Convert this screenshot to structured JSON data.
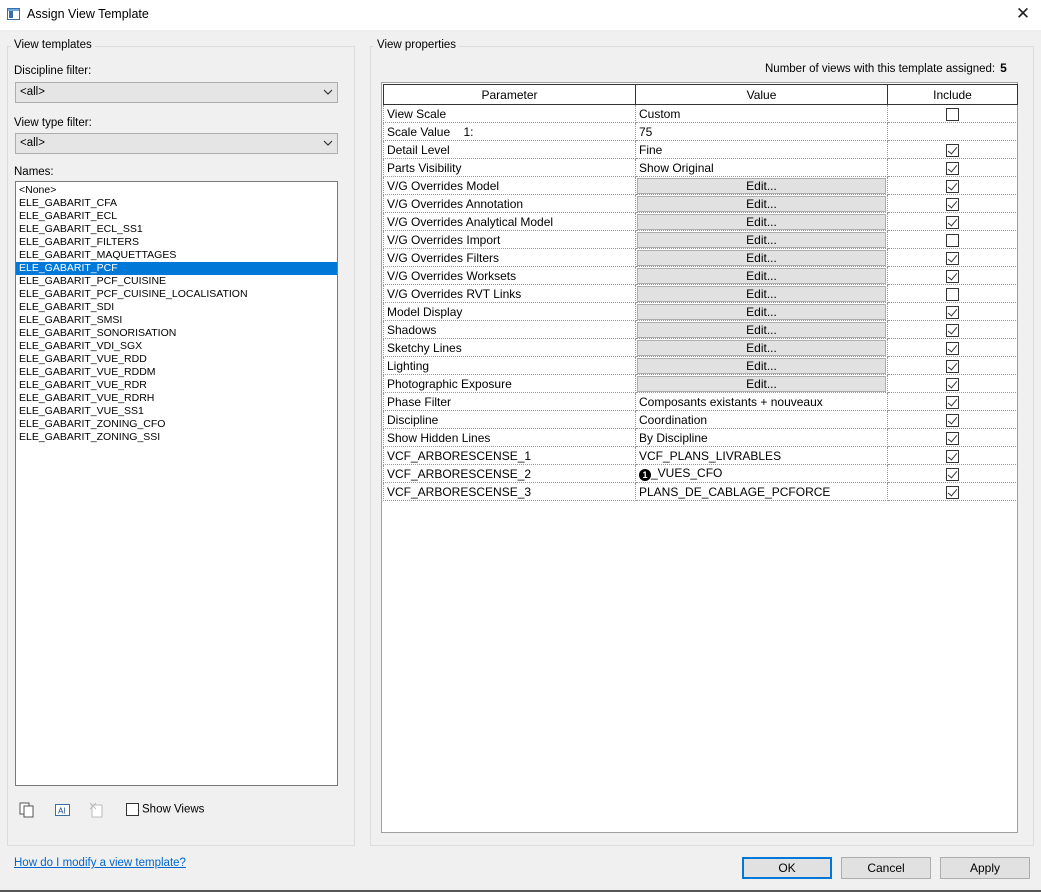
{
  "window": {
    "title": "Assign View Template",
    "close_glyph": "✕"
  },
  "left": {
    "group_title": "View templates",
    "discipline_filter": {
      "label": "Discipline filter:",
      "value": "<all>"
    },
    "view_type_filter": {
      "label": "View type filter:",
      "value": "<all>"
    },
    "names_label": "Names:",
    "names": [
      "<None>",
      "ELE_GABARIT_CFA",
      "ELE_GABARIT_ECL",
      "ELE_GABARIT_ECL_SS1",
      "ELE_GABARIT_FILTERS",
      "ELE_GABARIT_MAQUETTAGES",
      "ELE_GABARIT_PCF",
      "ELE_GABARIT_PCF_CUISINE",
      "ELE_GABARIT_PCF_CUISINE_LOCALISATION",
      "ELE_GABARIT_SDI",
      "ELE_GABARIT_SMSI",
      "ELE_GABARIT_SONORISATION",
      "ELE_GABARIT_VDI_SGX",
      "ELE_GABARIT_VUE_RDD",
      "ELE_GABARIT_VUE_RDDM",
      "ELE_GABARIT_VUE_RDR",
      "ELE_GABARIT_VUE_RDRH",
      "ELE_GABARIT_VUE_SS1",
      "ELE_GABARIT_ZONING_CFO",
      "ELE_GABARIT_ZONING_SSI"
    ],
    "selected_name": "ELE_GABARIT_PCF",
    "tools": [
      "duplicate-icon",
      "rename-icon",
      "delete-icon"
    ],
    "show_views_label": "Show Views",
    "show_views_checked": false
  },
  "right": {
    "group_title": "View properties",
    "count_label": "Number of views with this template assigned:",
    "count_value": "5",
    "columns": [
      "Parameter",
      "Value",
      "Include"
    ],
    "rows": [
      {
        "param": "View Scale",
        "value": "Custom",
        "edit": false,
        "include": false
      },
      {
        "param": "Scale Value    1:",
        "value": "75",
        "edit": false,
        "include": null
      },
      {
        "param": "Detail Level",
        "value": "Fine",
        "edit": false,
        "include": true
      },
      {
        "param": "Parts Visibility",
        "value": "Show Original",
        "edit": false,
        "include": true
      },
      {
        "param": "V/G Overrides Model",
        "value": "Edit...",
        "edit": true,
        "include": true
      },
      {
        "param": "V/G Overrides Annotation",
        "value": "Edit...",
        "edit": true,
        "include": true
      },
      {
        "param": "V/G Overrides Analytical Model",
        "value": "Edit...",
        "edit": true,
        "include": true
      },
      {
        "param": "V/G Overrides Import",
        "value": "Edit...",
        "edit": true,
        "include": false
      },
      {
        "param": "V/G Overrides Filters",
        "value": "Edit...",
        "edit": true,
        "include": true
      },
      {
        "param": "V/G Overrides Worksets",
        "value": "Edit...",
        "edit": true,
        "include": true
      },
      {
        "param": "V/G Overrides RVT Links",
        "value": "Edit...",
        "edit": true,
        "include": false
      },
      {
        "param": "Model Display",
        "value": "Edit...",
        "edit": true,
        "include": true
      },
      {
        "param": "Shadows",
        "value": "Edit...",
        "edit": true,
        "include": true
      },
      {
        "param": "Sketchy Lines",
        "value": "Edit...",
        "edit": true,
        "include": true
      },
      {
        "param": "Lighting",
        "value": "Edit...",
        "edit": true,
        "include": true
      },
      {
        "param": "Photographic Exposure",
        "value": "Edit...",
        "edit": true,
        "include": true
      },
      {
        "param": "Phase Filter",
        "value": "Composants existants + nouveaux",
        "edit": false,
        "include": true
      },
      {
        "param": "Discipline",
        "value": "Coordination",
        "edit": false,
        "include": true
      },
      {
        "param": "Show Hidden Lines",
        "value": "By Discipline",
        "edit": false,
        "include": true
      },
      {
        "param": "VCF_ARBORESCENSE_1",
        "value": "VCF_PLANS_LIVRABLES",
        "edit": false,
        "include": true
      },
      {
        "param": "VCF_ARBORESCENSE_2",
        "value": "_VUES_CFO",
        "badge": "1",
        "edit": false,
        "include": true
      },
      {
        "param": "VCF_ARBORESCENSE_3",
        "value": "PLANS_DE_CABLAGE_PCFORCE",
        "edit": false,
        "include": true
      }
    ]
  },
  "footer": {
    "help_link": "How do I modify a view template?",
    "ok": "OK",
    "cancel": "Cancel",
    "apply": "Apply"
  },
  "colors": {
    "selection": "#0078d7",
    "link": "#0066cc",
    "dialog_bg": "#f0f0f0"
  }
}
